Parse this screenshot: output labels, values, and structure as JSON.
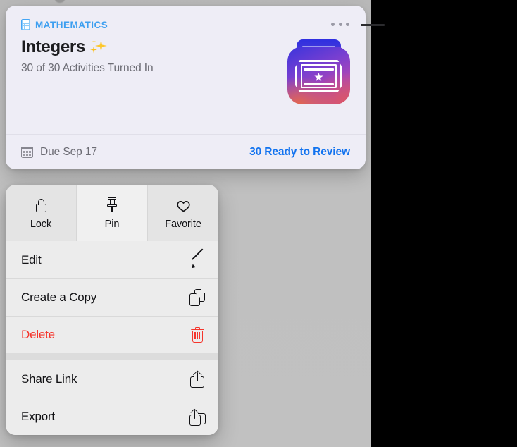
{
  "colors": {
    "accent_blue": "#1273ef",
    "subject_blue": "#3d9ff0",
    "danger_red": "#f5352c",
    "card_bg": "#eeedf6",
    "menu_bg": "#ececec",
    "backdrop": "#c0c0c0"
  },
  "card": {
    "subject_icon": "calculator-icon",
    "subject": "MATHEMATICS",
    "title": "Integers",
    "title_emoji": "sparkles-emoji",
    "subtitle": "30 of 30 Activities Turned In",
    "more_icon": "ellipsis-icon",
    "app_icon": "schoolwork-app-icon",
    "footer": {
      "due_icon": "calendar-icon",
      "due_label": "Due Sep 17",
      "review_label": "30 Ready to Review"
    }
  },
  "callout": {
    "leader_line": "callout-leader-line"
  },
  "menu": {
    "segments": [
      {
        "label": "Lock",
        "icon": "lock-icon"
      },
      {
        "label": "Pin",
        "icon": "pin-icon"
      },
      {
        "label": "Favorite",
        "icon": "heart-icon"
      }
    ],
    "groups": [
      {
        "items": [
          {
            "label": "Edit",
            "icon": "pencil-icon",
            "danger": false
          },
          {
            "label": "Create a Copy",
            "icon": "copy-icon",
            "danger": false
          },
          {
            "label": "Delete",
            "icon": "trash-icon",
            "danger": true
          }
        ]
      },
      {
        "items": [
          {
            "label": "Share Link",
            "icon": "share-icon",
            "danger": false
          },
          {
            "label": "Export",
            "icon": "export-icon",
            "danger": false
          }
        ]
      }
    ]
  }
}
